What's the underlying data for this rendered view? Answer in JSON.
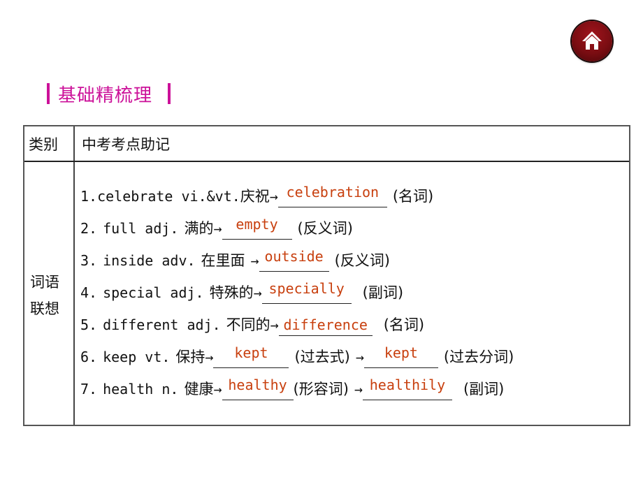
{
  "home_button": {
    "icon": "home-icon",
    "color": "#7a0d12"
  },
  "section": {
    "title": "基础精梳理",
    "accent": "#cc1199"
  },
  "table": {
    "headers": {
      "category": "类别",
      "content": "中考考点助记"
    },
    "category_label_line1": "词语",
    "category_label_line2": "联想",
    "answer_color": "#c8400f",
    "items": [
      {
        "num": "1.",
        "word": "celebrate vi.&vt.",
        "meaning": "庆祝",
        "arrow": "→",
        "answer1": "celebration",
        "note1": "(名词)"
      },
      {
        "num": "2.",
        "word": "full adj.",
        "meaning": "满的",
        "arrow": "→",
        "answer1": "empty",
        "note1": "(反义词)"
      },
      {
        "num": "3.",
        "word": "inside adv.",
        "meaning": "在里面",
        "arrow": "→",
        "answer1": "outside",
        "note1": "(反义词)"
      },
      {
        "num": "4.",
        "word": "special adj.",
        "meaning": "特殊的",
        "arrow": "→",
        "answer1": "specially",
        "note1": "(副词)"
      },
      {
        "num": "5.",
        "word": "different adj.",
        "meaning": "不同的",
        "arrow": "→",
        "answer1": "difference",
        "note1": "(名词)"
      },
      {
        "num": "6.",
        "word": "keep vt.",
        "meaning": "保持",
        "arrow": "→",
        "answer1": "kept",
        "note1": "(过去式)",
        "arrow2": "→",
        "answer2": "kept",
        "note2": "(过去分词)"
      },
      {
        "num": "7.",
        "word": "health n.",
        "meaning": "健康",
        "arrow": "→",
        "answer1": "healthy",
        "note1": "(形容词)",
        "arrow2": "→",
        "answer2": "healthily",
        "note2": "(副词)"
      }
    ]
  }
}
